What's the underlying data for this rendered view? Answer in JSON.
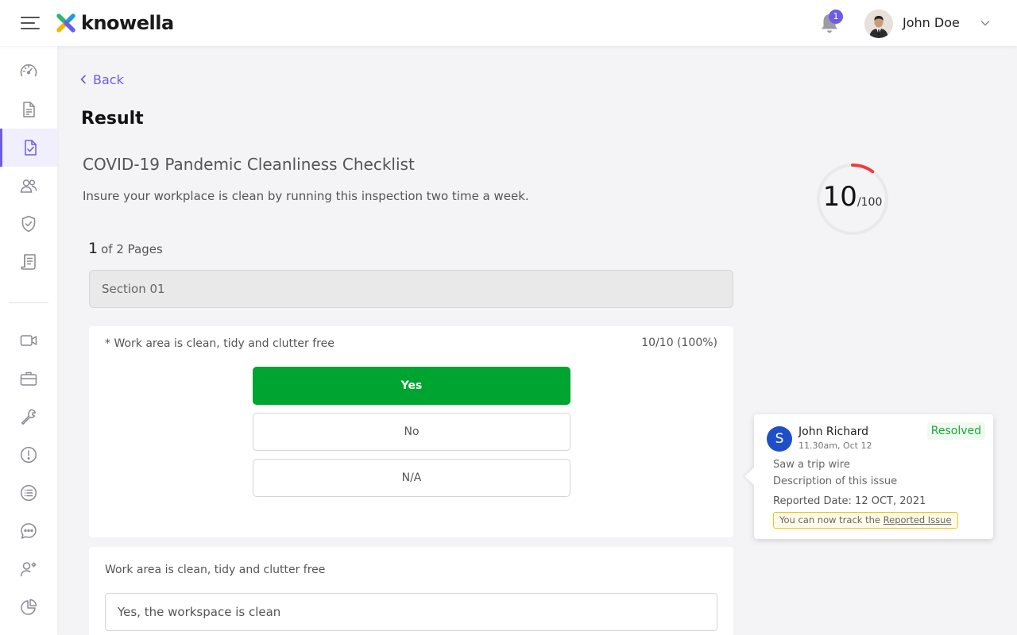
{
  "header": {
    "logo_text": "knowella",
    "notification_count": "1",
    "user_name": "John Doe"
  },
  "sidebar": {
    "items": [
      {
        "icon": "dashboard-icon"
      },
      {
        "icon": "document-icon"
      },
      {
        "icon": "checklist-icon",
        "active": true
      },
      {
        "icon": "users-icon"
      },
      {
        "icon": "shield-check-icon"
      },
      {
        "icon": "receipt-icon"
      },
      {
        "icon": "video-icon"
      },
      {
        "icon": "briefcase-icon"
      },
      {
        "icon": "wrench-icon"
      },
      {
        "icon": "alert-icon"
      },
      {
        "icon": "list-icon"
      },
      {
        "icon": "chat-icon"
      },
      {
        "icon": "user-settings-icon"
      },
      {
        "icon": "pie-chart-icon"
      }
    ]
  },
  "main": {
    "back_label": "Back",
    "page_title": "Result",
    "checklist_title": "COVID-19 Pandemic Cleanliness Checklist",
    "checklist_description": "Insure your workplace is clean by running this inspection two time a week.",
    "page_current": "1",
    "page_of_text": "of 2 Pages",
    "section_label": "Section 01",
    "question1": {
      "label": "* Work area is clean, tidy and clutter free",
      "score": "10/10 (100%)",
      "options": [
        "Yes",
        "No",
        "N/A"
      ],
      "selected": "Yes"
    },
    "question2": {
      "label": "Work area is clean, tidy and clutter free",
      "answer": "Yes, the workspace is clean"
    }
  },
  "score": {
    "value": "10",
    "max": "/100",
    "fraction": 0.1,
    "ring_color": "#f03c3c",
    "track_color": "#e9e9ec"
  },
  "comment": {
    "avatar_letter": "S",
    "name": "John Richard",
    "time": "11.30am, Oct 12",
    "status": "Resolved",
    "title": "Saw a trip wire",
    "description": "Description of this issue",
    "reported_date": "Reported Date: 12 OCT, 2021",
    "notice_prefix": "You can now track the",
    "notice_link": "Reported Issue"
  },
  "colors": {
    "accent": "#6c5ce7",
    "selected_green": "#00a430",
    "resolved_green": "#23a23a",
    "avatar_blue": "#1f4fc7"
  }
}
